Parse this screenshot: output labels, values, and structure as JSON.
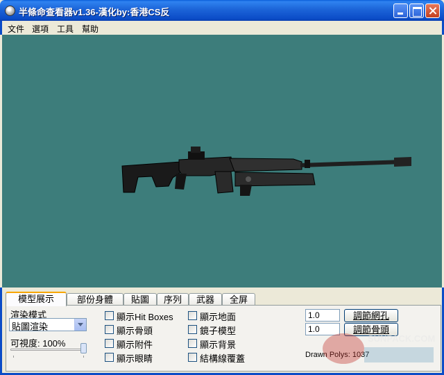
{
  "window": {
    "title": "半條命查看器v1.36-漢化by:香港CS反",
    "minimize_label": "minimize",
    "maximize_label": "maximize",
    "close_label": "close"
  },
  "menu": [
    "文件",
    "選項",
    "工具",
    "幫助"
  ],
  "tabs": [
    "模型展示",
    "部份身體",
    "貼圖",
    "序列",
    "武器",
    "全屏"
  ],
  "active_tab": 0,
  "render": {
    "mode_label": "渲染模式",
    "mode_value": "貼圖渲染",
    "visibility_label": "可視度: 100%",
    "visibility_percent": 100
  },
  "checkboxes_col1": [
    "顯示Hit Boxes",
    "顯示骨頭",
    "顯示附件",
    "顯示眼睛"
  ],
  "checkboxes_col2": [
    "顯示地面",
    "鏡子模型",
    "顯示背景",
    "結構線覆蓋"
  ],
  "grid_value": "1.0",
  "bone_value": "1.0",
  "buttons": {
    "grid": "調節網孔",
    "bone": "調節骨頭"
  },
  "drawn_polys": "Drawn Polys: 1037",
  "watermark_text": "SUNPACK.COM",
  "colors": {
    "viewport_bg": "#3d7d7b",
    "title_bar": "#0b4cc7",
    "panel_bg": "#ece9d8"
  }
}
